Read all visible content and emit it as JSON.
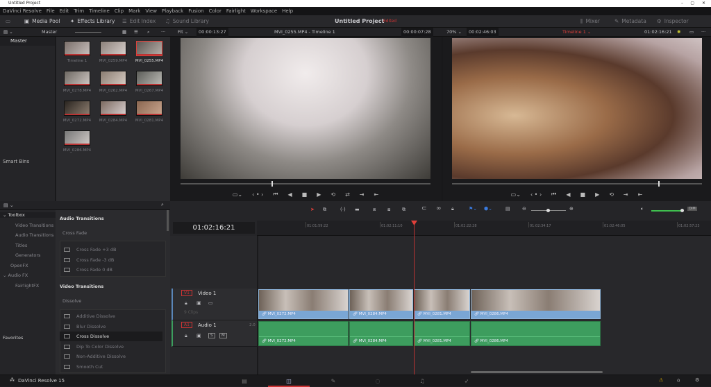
{
  "window": {
    "title": "Untitled Project"
  },
  "menu": [
    "DaVinci Resolve",
    "File",
    "Edit",
    "Trim",
    "Timeline",
    "Clip",
    "Mark",
    "View",
    "Playback",
    "Fusion",
    "Color",
    "Fairlight",
    "Workspace",
    "Help"
  ],
  "toolbar": {
    "media_pool": "Media Pool",
    "effects_library": "Effects Library",
    "edit_index": "Edit Index",
    "sound_library": "Sound Library",
    "project_title": "Untitled Project",
    "project_status": "Edited",
    "mixer": "Mixer",
    "metadata": "Metadata",
    "inspector": "Inspector"
  },
  "subbar": {
    "bin": "Master",
    "source_zoom": "Fit",
    "source_duration": "00:00:13:27",
    "source_clip": "MVI_0255.MP4 - Timeline 1",
    "source_timecode": "00:00:07:28",
    "program_zoom": "70%",
    "program_duration": "00:02:46:03",
    "timeline_name": "Timeline 1",
    "program_timecode": "01:02:16:21"
  },
  "bins": {
    "master": "Master",
    "smart_bins": "Smart Bins"
  },
  "media_pool": {
    "items": [
      {
        "name": "Timeline 1",
        "selected": false
      },
      {
        "name": "MVI_0259.MP4",
        "selected": false
      },
      {
        "name": "MVI_0255.MP4",
        "selected": true
      },
      {
        "name": "MVI_0278.MP4",
        "selected": false
      },
      {
        "name": "MVI_0262.MP4",
        "selected": false
      },
      {
        "name": "MVI_0267.MP4",
        "selected": false
      },
      {
        "name": "MVI_0272.MP4",
        "selected": false
      },
      {
        "name": "MVI_0284.MP4",
        "selected": false
      },
      {
        "name": "MVI_0281.MP4",
        "selected": false
      },
      {
        "name": "MVI_0286.MP4",
        "selected": false
      }
    ]
  },
  "effects": {
    "tree": [
      {
        "label": "Toolbox",
        "level": 0,
        "expanded": true
      },
      {
        "label": "Video Transitions",
        "level": 1
      },
      {
        "label": "Audio Transitions",
        "level": 1
      },
      {
        "label": "Titles",
        "level": 1
      },
      {
        "label": "Generators",
        "level": 1
      },
      {
        "label": "OpenFX",
        "level": 0
      },
      {
        "label": "Audio FX",
        "level": 0,
        "expanded": true
      },
      {
        "label": "FairlightFX",
        "level": 1
      }
    ],
    "favorites": "Favorites",
    "audio_transitions": "Audio Transitions",
    "cross_fade": "Cross Fade",
    "audio_items": [
      "Cross Fade +3 dB",
      "Cross Fade -3 dB",
      "Cross Fade 0 dB"
    ],
    "video_transitions": "Video Transitions",
    "dissolve": "Dissolve",
    "video_items": [
      "Additive Dissolve",
      "Blur Dissolve",
      "Cross Dissolve",
      "Dip To Color Dissolve",
      "Non-Additive Dissolve",
      "Smooth Cut"
    ],
    "selected": "Cross Dissolve"
  },
  "timeline": {
    "timecode": "01:02:16:21",
    "ruler": [
      "01:01:59:22",
      "01:02:11:10",
      "01:02:22:28",
      "01:02:34:17",
      "01:02:46:05",
      "01:02:57:23"
    ],
    "video_track": {
      "id": "V1",
      "name": "Video 1",
      "clips_count": "9 Clips"
    },
    "audio_track": {
      "id": "A1",
      "name": "Audio 1",
      "channels": "2.0"
    },
    "clips": [
      "MVI_0272.MP4",
      "MVI_0284.MP4",
      "MVI_0281.MP4",
      "MVI_0286.MP4"
    ]
  },
  "footer": {
    "app": "DaVinci Resolve 15",
    "pages": [
      "media",
      "edit",
      "fusion",
      "color",
      "fairlight",
      "deliver"
    ],
    "active_page": "edit"
  },
  "colors": {
    "accent_red": "#e0403a",
    "video_clip": "#7aa6d4",
    "audio_clip": "#3d9d5e",
    "playhead": "#e0403a"
  }
}
